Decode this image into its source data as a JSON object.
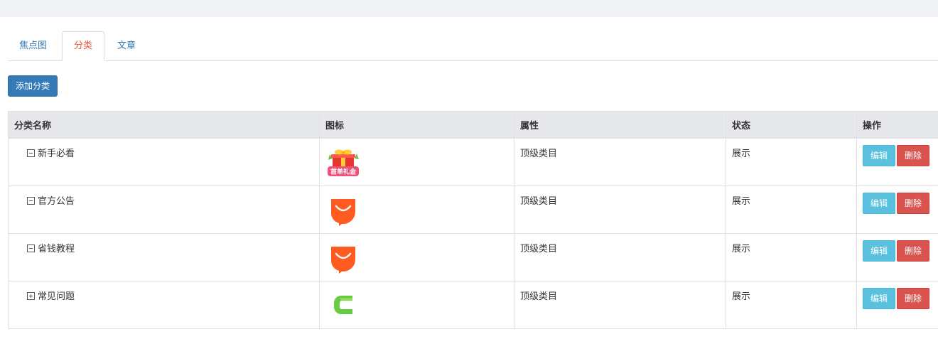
{
  "tabs": [
    {
      "label": "焦点图",
      "active": false
    },
    {
      "label": "分类",
      "active": true
    },
    {
      "label": "文章",
      "active": false
    }
  ],
  "toolbar": {
    "add_label": "添加分类"
  },
  "table": {
    "headers": [
      "分类名称",
      "图标",
      "属性",
      "状态",
      "操作"
    ],
    "rows": [
      {
        "name": "新手必看",
        "expanded": true,
        "icon": "gift-coupon-icon",
        "attr": "顶级类目",
        "status": "展示",
        "edit": "编辑",
        "delete": "删除"
      },
      {
        "name": "官方公告",
        "expanded": true,
        "icon": "orange-smile-icon",
        "attr": "顶级类目",
        "status": "展示",
        "edit": "编辑",
        "delete": "删除"
      },
      {
        "name": "省钱教程",
        "expanded": true,
        "icon": "orange-smile-icon",
        "attr": "顶级类目",
        "status": "展示",
        "edit": "编辑",
        "delete": "删除"
      },
      {
        "name": "常见问题",
        "expanded": false,
        "icon": "green-c-icon",
        "attr": "顶级类目",
        "status": "展示",
        "edit": "编辑",
        "delete": "删除"
      }
    ]
  },
  "gift_icon_text": "首单礼金",
  "colors": {
    "tab_link": "#337ab7",
    "tab_active": "#e9573f",
    "primary": "#337ab7",
    "info": "#5bc0de",
    "danger": "#d9534f",
    "header_bg": "#e6e7ea",
    "topbar_bg": "#f0f2f5"
  }
}
